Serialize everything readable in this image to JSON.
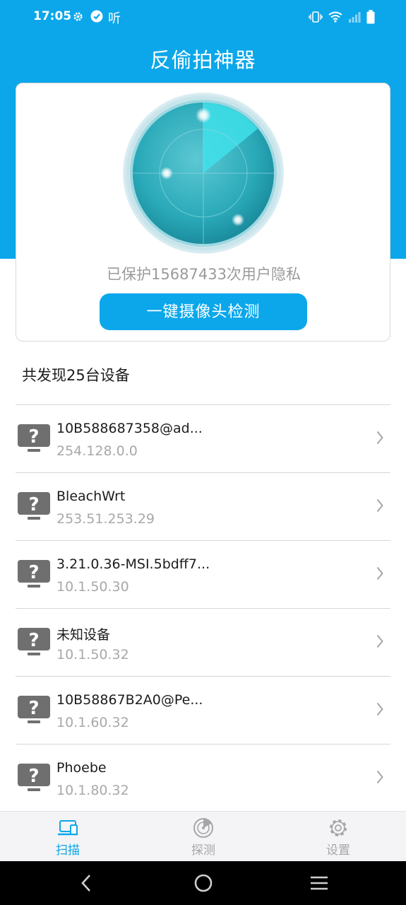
{
  "status_bar": {
    "time": "17:05",
    "listen_label": "听",
    "icons": [
      "gear-icon",
      "check-circle-icon",
      "vibrate-icon",
      "wifi-icon",
      "signal-icon",
      "battery-icon"
    ]
  },
  "app": {
    "title": "反偷拍神器"
  },
  "card": {
    "protect_text": "已保护15687433次用户隐私",
    "scan_button_label": "一键摄像头检测"
  },
  "devices": {
    "found_title": "共发现25台设备",
    "items": [
      {
        "name": "10B588687358@ad...",
        "ip": "254.128.0.0"
      },
      {
        "name": "BleachWrt",
        "ip": "253.51.253.29"
      },
      {
        "name": "3.21.0.36-MSI.5bdff7...",
        "ip": "10.1.50.30"
      },
      {
        "name": "未知设备",
        "ip": "10.1.50.32"
      },
      {
        "name": "10B58867B2A0@Pe...",
        "ip": "10.1.60.32"
      },
      {
        "name": "Phoebe",
        "ip": "10.1.80.32"
      }
    ]
  },
  "tabs": [
    {
      "label": "扫描",
      "icon": "laptop-icon",
      "active": true
    },
    {
      "label": "探测",
      "icon": "radar-icon",
      "active": false
    },
    {
      "label": "设置",
      "icon": "gear-icon",
      "active": false
    }
  ],
  "colors": {
    "primary": "#0ba7ea",
    "muted_text": "#a8a8a8",
    "tab_inactive": "#a6a6a6"
  }
}
